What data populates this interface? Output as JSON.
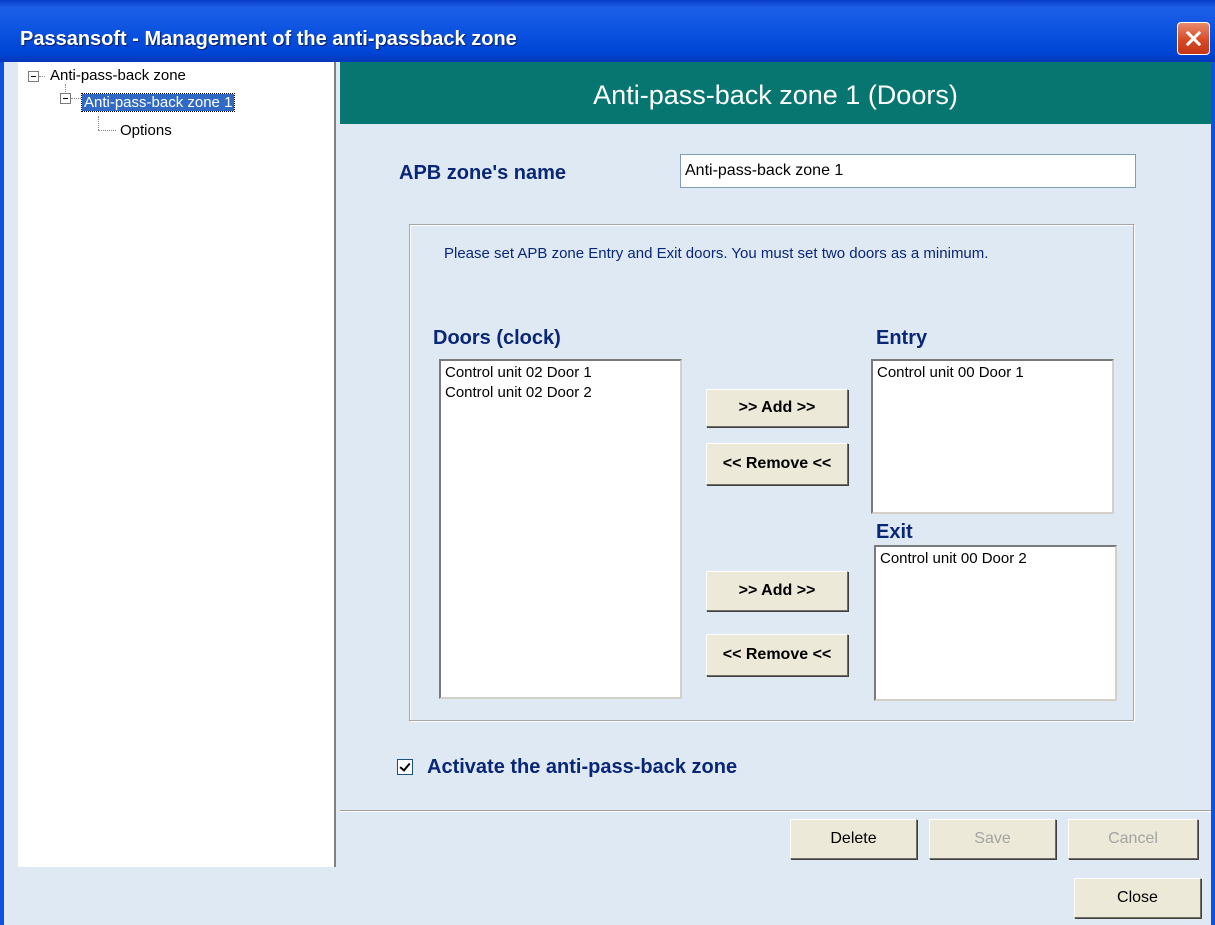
{
  "window": {
    "title": "Passansoft - Management of the anti-passback zone"
  },
  "tree": {
    "root": "Anti-pass-back zone",
    "child": "Anti-pass-back zone 1",
    "grandchild": "Options"
  },
  "panel": {
    "header": "Anti-pass-back zone 1 (Doors)",
    "name_label": "APB zone's name",
    "name_value": "Anti-pass-back zone 1",
    "instructions": "Please set APB zone Entry and Exit doors. You must set two doors as a minimum.",
    "doors_label": "Doors (clock)",
    "doors": [
      "Control unit 02 Door 1",
      "Control unit 02 Door 2"
    ],
    "entry_label": "Entry",
    "entry": [
      "Control unit 00 Door 1"
    ],
    "exit_label": "Exit",
    "exit": [
      "Control unit 00 Door 2"
    ],
    "add_label": ">> Add >>",
    "remove_label": "<< Remove <<",
    "activate_label": "Activate the anti-pass-back zone",
    "activate_checked": true
  },
  "footer": {
    "delete": "Delete",
    "save": "Save",
    "cancel": "Cancel",
    "close": "Close"
  }
}
